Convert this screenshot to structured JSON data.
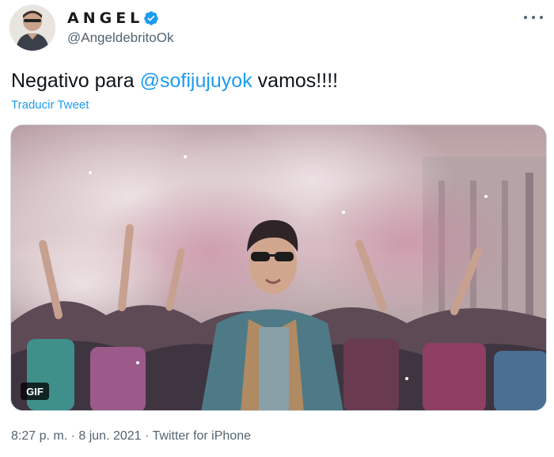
{
  "author": {
    "display_name": "ANGEL",
    "handle": "@AngeldebritoOk",
    "verified": true,
    "avatar_icon": "profile-photo"
  },
  "tweet": {
    "text_before": "Negativo para ",
    "mention": "@sofijujuyok",
    "text_after": " vamos!!!!",
    "translate_label": "Traducir Tweet"
  },
  "media": {
    "badge": "GIF"
  },
  "meta": {
    "time": "8:27 p. m.",
    "separator1": " · ",
    "date": "8 jun. 2021",
    "separator2": " · ",
    "source": "Twitter for iPhone"
  },
  "colors": {
    "link": "#1d9bf0",
    "secondary_text": "#536471",
    "verified": "#1d9bf0"
  }
}
